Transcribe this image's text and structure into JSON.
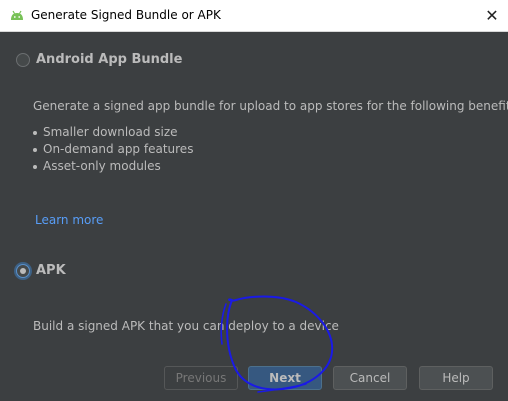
{
  "window": {
    "title": "Generate Signed Bundle or APK",
    "icon": "android-icon",
    "close_glyph": "✕"
  },
  "options": {
    "bundle": {
      "label": "Android App Bundle",
      "selected": false,
      "description": "Generate a signed app bundle for upload to app stores for the following benefits:",
      "benefits": [
        "Smaller download size",
        "On-demand app features",
        "Asset-only modules"
      ],
      "link_text": "Learn more"
    },
    "apk": {
      "label": "APK",
      "selected": true,
      "description": "Build a signed APK that you can deploy to a device"
    }
  },
  "buttons": {
    "previous": "Previous",
    "next": "Next",
    "cancel": "Cancel",
    "help": "Help"
  },
  "colors": {
    "background": "#3c3f41",
    "text": "#bbbbbb",
    "link": "#589df6",
    "default_button": "#365880",
    "annotation_ink": "#1a1ae6"
  }
}
